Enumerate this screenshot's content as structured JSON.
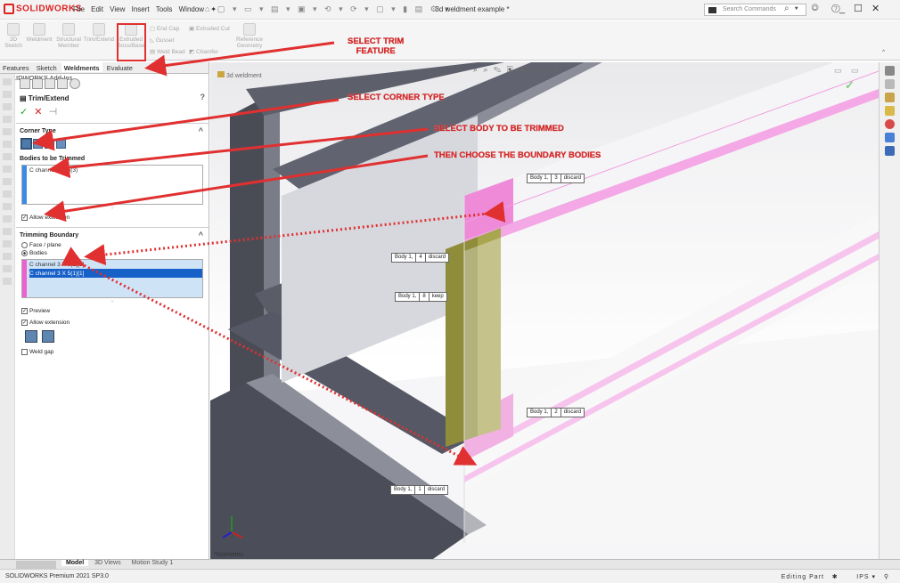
{
  "app": {
    "brand": "SOLIDWORKS",
    "title": "3d weldment example *",
    "menus": [
      "File",
      "Edit",
      "View",
      "Insert",
      "Tools",
      "Window"
    ],
    "search_placeholder": "Search Commands"
  },
  "command_manager": {
    "sketch": "3D\nSketch",
    "weldment": "Weldment",
    "structural": "Structural\nMember",
    "trim_extend": "Trim/Extend",
    "extruded_boss": "Extruded\nBoss/Base",
    "end_cap": "End Cap",
    "gusset": "Gusset",
    "weld_bead": "Weld Bead",
    "extruded_cut": "Extruded Cut",
    "chamfer": "Chamfer",
    "reference": "Reference\nGeometry"
  },
  "panel_tabs": [
    "Features",
    "Sketch",
    "Weldments",
    "Evaluate",
    "SOLIDWORKS Add-Ins"
  ],
  "property_manager": {
    "title": "Trim/Extend",
    "corner_type_heading": "Corner Type",
    "bodies_heading": "Bodies to be Trimmed",
    "bodies": [
      "C channel 3 X 5(3)"
    ],
    "allow_extension_1": "Allow extension",
    "boundary_heading": "Trimming Boundary",
    "face_plane": "Face / plane",
    "bodies_option": "Bodies",
    "boundary_bodies": [
      "C channel 3 X 5(1)[3]",
      "C channel 3 X 5(1)[1]"
    ],
    "preview": "Preview",
    "allow_extension_2": "Allow extension",
    "weld_gap": "Weld gap"
  },
  "viewport": {
    "breadcrumb": "3d weldment",
    "view_label": "*Isometric",
    "tags": [
      {
        "body": "Body 1,",
        "num": "3",
        "state": "discard"
      },
      {
        "body": "Body 1,",
        "num": "4",
        "state": "discard"
      },
      {
        "body": "Body 1,",
        "num": "8",
        "state": "keep"
      },
      {
        "body": "Body 1,",
        "num": "2",
        "state": "discard"
      },
      {
        "body": "Body 1,",
        "num": "1",
        "state": "discard"
      }
    ]
  },
  "callouts": {
    "trim": "SELECT TRIM\nFEATURE",
    "corner": "SELECT CORNER TYPE",
    "body": "SELECT BODY TO BE TRIMMED",
    "boundary": "THEN CHOOSE THE BOUNDARY BODIES"
  },
  "bottom_tabs": [
    "Model",
    "3D Views",
    "Motion Study 1"
  ],
  "status": {
    "left": "SOLIDWORKS Premium 2021 SP3.0",
    "right": "Editing Part",
    "units": "IPS"
  },
  "colors": {
    "accent_red": "#e03030",
    "selection_pink": "#ee5fd0",
    "selection_blue": "#1660c8"
  }
}
